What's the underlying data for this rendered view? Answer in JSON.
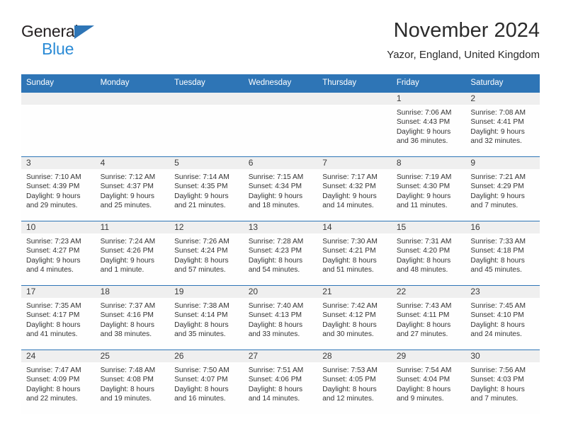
{
  "brand": {
    "name_top": "General",
    "name_bottom": "Blue",
    "triangle_color": "#2e75b6",
    "blue_color": "#2b8bd6"
  },
  "header": {
    "title": "November 2024",
    "subtitle": "Yazor, England, United Kingdom"
  },
  "theme": {
    "header_bg": "#2e75b6",
    "daynum_bg": "#efefef",
    "row_line": "#2e75b6",
    "text": "#333333"
  },
  "weekday_headers": [
    "Sunday",
    "Monday",
    "Tuesday",
    "Wednesday",
    "Thursday",
    "Friday",
    "Saturday"
  ],
  "weeks": [
    [
      {
        "day": "",
        "empty": true
      },
      {
        "day": "",
        "empty": true
      },
      {
        "day": "",
        "empty": true
      },
      {
        "day": "",
        "empty": true
      },
      {
        "day": "",
        "empty": true
      },
      {
        "day": "1",
        "sunrise": "Sunrise: 7:06 AM",
        "sunset": "Sunset: 4:43 PM",
        "daylight": "Daylight: 9 hours and 36 minutes."
      },
      {
        "day": "2",
        "sunrise": "Sunrise: 7:08 AM",
        "sunset": "Sunset: 4:41 PM",
        "daylight": "Daylight: 9 hours and 32 minutes."
      }
    ],
    [
      {
        "day": "3",
        "sunrise": "Sunrise: 7:10 AM",
        "sunset": "Sunset: 4:39 PM",
        "daylight": "Daylight: 9 hours and 29 minutes."
      },
      {
        "day": "4",
        "sunrise": "Sunrise: 7:12 AM",
        "sunset": "Sunset: 4:37 PM",
        "daylight": "Daylight: 9 hours and 25 minutes."
      },
      {
        "day": "5",
        "sunrise": "Sunrise: 7:14 AM",
        "sunset": "Sunset: 4:35 PM",
        "daylight": "Daylight: 9 hours and 21 minutes."
      },
      {
        "day": "6",
        "sunrise": "Sunrise: 7:15 AM",
        "sunset": "Sunset: 4:34 PM",
        "daylight": "Daylight: 9 hours and 18 minutes."
      },
      {
        "day": "7",
        "sunrise": "Sunrise: 7:17 AM",
        "sunset": "Sunset: 4:32 PM",
        "daylight": "Daylight: 9 hours and 14 minutes."
      },
      {
        "day": "8",
        "sunrise": "Sunrise: 7:19 AM",
        "sunset": "Sunset: 4:30 PM",
        "daylight": "Daylight: 9 hours and 11 minutes."
      },
      {
        "day": "9",
        "sunrise": "Sunrise: 7:21 AM",
        "sunset": "Sunset: 4:29 PM",
        "daylight": "Daylight: 9 hours and 7 minutes."
      }
    ],
    [
      {
        "day": "10",
        "sunrise": "Sunrise: 7:23 AM",
        "sunset": "Sunset: 4:27 PM",
        "daylight": "Daylight: 9 hours and 4 minutes."
      },
      {
        "day": "11",
        "sunrise": "Sunrise: 7:24 AM",
        "sunset": "Sunset: 4:26 PM",
        "daylight": "Daylight: 9 hours and 1 minute."
      },
      {
        "day": "12",
        "sunrise": "Sunrise: 7:26 AM",
        "sunset": "Sunset: 4:24 PM",
        "daylight": "Daylight: 8 hours and 57 minutes."
      },
      {
        "day": "13",
        "sunrise": "Sunrise: 7:28 AM",
        "sunset": "Sunset: 4:23 PM",
        "daylight": "Daylight: 8 hours and 54 minutes."
      },
      {
        "day": "14",
        "sunrise": "Sunrise: 7:30 AM",
        "sunset": "Sunset: 4:21 PM",
        "daylight": "Daylight: 8 hours and 51 minutes."
      },
      {
        "day": "15",
        "sunrise": "Sunrise: 7:31 AM",
        "sunset": "Sunset: 4:20 PM",
        "daylight": "Daylight: 8 hours and 48 minutes."
      },
      {
        "day": "16",
        "sunrise": "Sunrise: 7:33 AM",
        "sunset": "Sunset: 4:18 PM",
        "daylight": "Daylight: 8 hours and 45 minutes."
      }
    ],
    [
      {
        "day": "17",
        "sunrise": "Sunrise: 7:35 AM",
        "sunset": "Sunset: 4:17 PM",
        "daylight": "Daylight: 8 hours and 41 minutes."
      },
      {
        "day": "18",
        "sunrise": "Sunrise: 7:37 AM",
        "sunset": "Sunset: 4:16 PM",
        "daylight": "Daylight: 8 hours and 38 minutes."
      },
      {
        "day": "19",
        "sunrise": "Sunrise: 7:38 AM",
        "sunset": "Sunset: 4:14 PM",
        "daylight": "Daylight: 8 hours and 35 minutes."
      },
      {
        "day": "20",
        "sunrise": "Sunrise: 7:40 AM",
        "sunset": "Sunset: 4:13 PM",
        "daylight": "Daylight: 8 hours and 33 minutes."
      },
      {
        "day": "21",
        "sunrise": "Sunrise: 7:42 AM",
        "sunset": "Sunset: 4:12 PM",
        "daylight": "Daylight: 8 hours and 30 minutes."
      },
      {
        "day": "22",
        "sunrise": "Sunrise: 7:43 AM",
        "sunset": "Sunset: 4:11 PM",
        "daylight": "Daylight: 8 hours and 27 minutes."
      },
      {
        "day": "23",
        "sunrise": "Sunrise: 7:45 AM",
        "sunset": "Sunset: 4:10 PM",
        "daylight": "Daylight: 8 hours and 24 minutes."
      }
    ],
    [
      {
        "day": "24",
        "sunrise": "Sunrise: 7:47 AM",
        "sunset": "Sunset: 4:09 PM",
        "daylight": "Daylight: 8 hours and 22 minutes."
      },
      {
        "day": "25",
        "sunrise": "Sunrise: 7:48 AM",
        "sunset": "Sunset: 4:08 PM",
        "daylight": "Daylight: 8 hours and 19 minutes."
      },
      {
        "day": "26",
        "sunrise": "Sunrise: 7:50 AM",
        "sunset": "Sunset: 4:07 PM",
        "daylight": "Daylight: 8 hours and 16 minutes."
      },
      {
        "day": "27",
        "sunrise": "Sunrise: 7:51 AM",
        "sunset": "Sunset: 4:06 PM",
        "daylight": "Daylight: 8 hours and 14 minutes."
      },
      {
        "day": "28",
        "sunrise": "Sunrise: 7:53 AM",
        "sunset": "Sunset: 4:05 PM",
        "daylight": "Daylight: 8 hours and 12 minutes."
      },
      {
        "day": "29",
        "sunrise": "Sunrise: 7:54 AM",
        "sunset": "Sunset: 4:04 PM",
        "daylight": "Daylight: 8 hours and 9 minutes."
      },
      {
        "day": "30",
        "sunrise": "Sunrise: 7:56 AM",
        "sunset": "Sunset: 4:03 PM",
        "daylight": "Daylight: 8 hours and 7 minutes."
      }
    ]
  ]
}
